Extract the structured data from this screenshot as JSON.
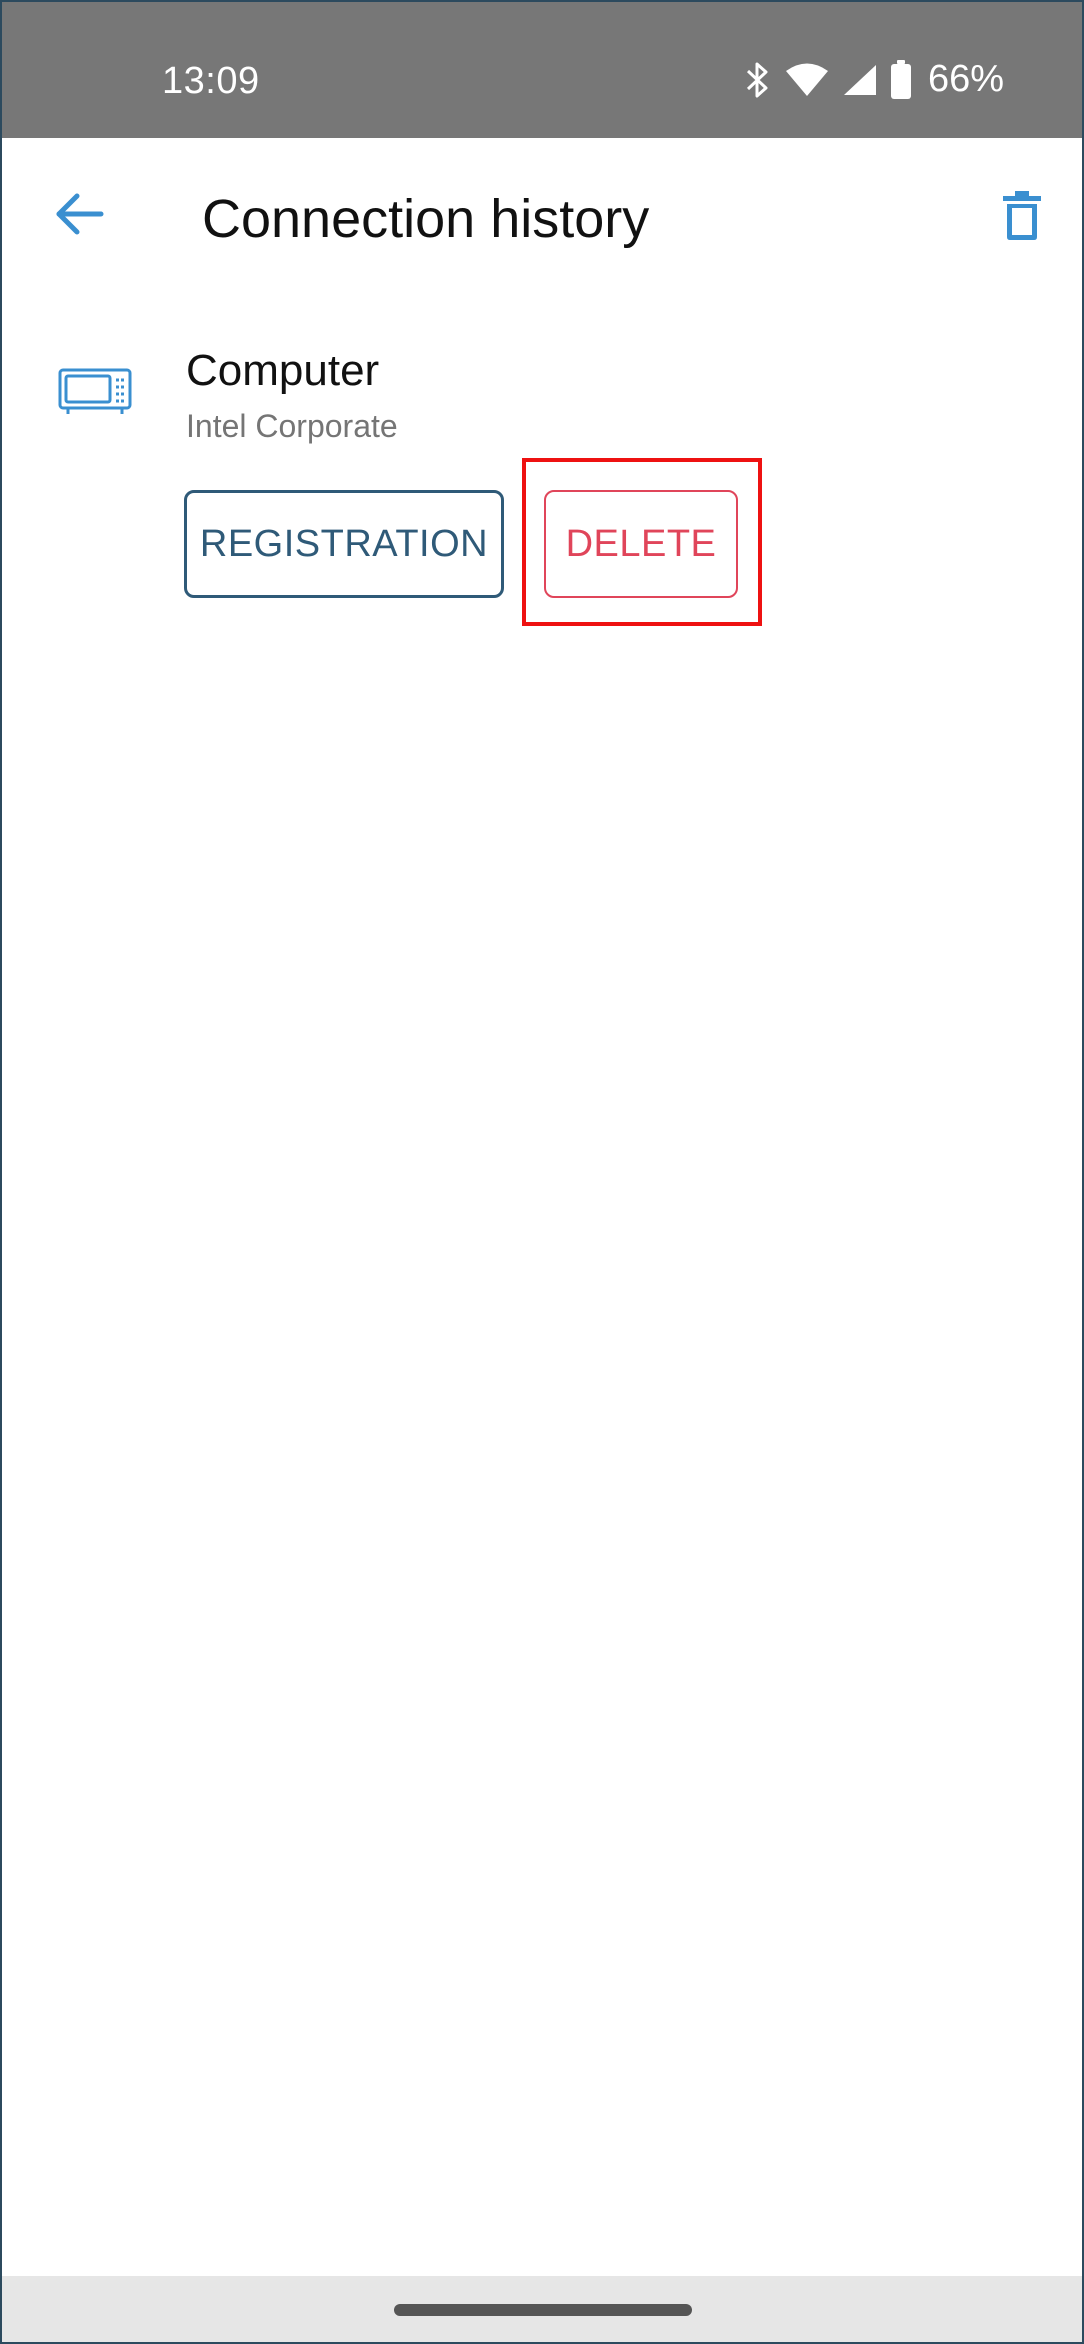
{
  "status_bar": {
    "time": "13:09",
    "battery_percent": "66%",
    "icons": [
      "bluetooth-icon",
      "wifi-icon",
      "cell-signal-icon",
      "battery-icon"
    ]
  },
  "app_bar": {
    "title": "Connection history",
    "back_icon": "arrow-left-icon",
    "delete_all_icon": "trash-icon"
  },
  "connection_history": [
    {
      "device_name": "Computer",
      "manufacturer": "Intel Corporate",
      "icon": "microwave-icon",
      "actions": {
        "registration_label": "REGISTRATION",
        "delete_label": "DELETE"
      }
    }
  ],
  "colors": {
    "status_bar_bg": "#777777",
    "accent_blue": "#3a8fd0",
    "registration_outline": "#2f5a78",
    "delete_red": "#e0455a",
    "highlight_red": "#ee1111"
  }
}
